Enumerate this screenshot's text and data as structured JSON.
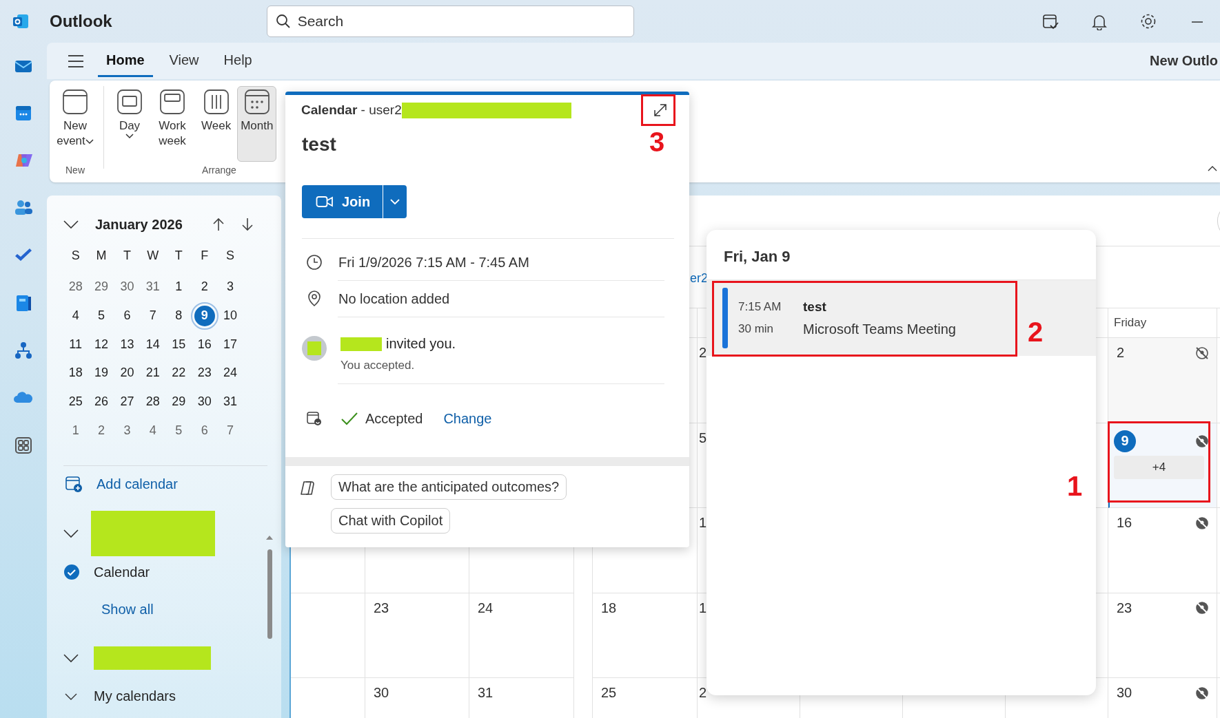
{
  "title_bar": {
    "app_name": "Outlook",
    "search": {
      "placeholder": "Search"
    }
  },
  "ribbon_tabs": [
    {
      "label": "Home",
      "selected": true
    },
    {
      "label": "View",
      "selected": false
    },
    {
      "label": "Help",
      "selected": false
    }
  ],
  "ribbon_banner": "New Outlo",
  "ribbon": {
    "groups": [
      {
        "label": "New",
        "buttons": [
          {
            "label": "New event",
            "kind": "event",
            "dropdown": true,
            "selected": false
          }
        ]
      },
      {
        "label": "Arrange",
        "buttons": [
          {
            "label": "Day",
            "kind": "day",
            "dropdown": true,
            "selected": false
          },
          {
            "label": "Work week",
            "kind": "workweek",
            "dropdown": false,
            "selected": false
          },
          {
            "label": "Week",
            "kind": "week",
            "dropdown": false,
            "selected": false
          },
          {
            "label": "Month",
            "kind": "month",
            "dropdown": false,
            "selected": true
          }
        ]
      }
    ]
  },
  "mini_calendar": {
    "title": "January 2026",
    "weekdays": [
      "S",
      "M",
      "T",
      "W",
      "T",
      "F",
      "S"
    ],
    "weeks": [
      [
        {
          "day": "28",
          "outside": true,
          "selected": false
        },
        {
          "day": "29",
          "outside": true,
          "selected": false
        },
        {
          "day": "30",
          "outside": true,
          "selected": false
        },
        {
          "day": "31",
          "outside": true,
          "selected": false
        },
        {
          "day": "1",
          "outside": false,
          "selected": false
        },
        {
          "day": "2",
          "outside": false,
          "selected": false
        },
        {
          "day": "3",
          "outside": false,
          "selected": false
        }
      ],
      [
        {
          "day": "4",
          "outside": false,
          "selected": false
        },
        {
          "day": "5",
          "outside": false,
          "selected": false
        },
        {
          "day": "6",
          "outside": false,
          "selected": false
        },
        {
          "day": "7",
          "outside": false,
          "selected": false
        },
        {
          "day": "8",
          "outside": false,
          "selected": false
        },
        {
          "day": "9",
          "outside": false,
          "selected": true
        },
        {
          "day": "10",
          "outside": false,
          "selected": false
        }
      ],
      [
        {
          "day": "11",
          "outside": false,
          "selected": false
        },
        {
          "day": "12",
          "outside": false,
          "selected": false
        },
        {
          "day": "13",
          "outside": false,
          "selected": false
        },
        {
          "day": "14",
          "outside": false,
          "selected": false
        },
        {
          "day": "15",
          "outside": false,
          "selected": false
        },
        {
          "day": "16",
          "outside": false,
          "selected": false
        },
        {
          "day": "17",
          "outside": false,
          "selected": false
        }
      ],
      [
        {
          "day": "18",
          "outside": false,
          "selected": false
        },
        {
          "day": "19",
          "outside": false,
          "selected": false
        },
        {
          "day": "20",
          "outside": false,
          "selected": false
        },
        {
          "day": "21",
          "outside": false,
          "selected": false
        },
        {
          "day": "22",
          "outside": false,
          "selected": false
        },
        {
          "day": "23",
          "outside": false,
          "selected": false
        },
        {
          "day": "24",
          "outside": false,
          "selected": false
        }
      ],
      [
        {
          "day": "25",
          "outside": false,
          "selected": false
        },
        {
          "day": "26",
          "outside": false,
          "selected": false
        },
        {
          "day": "27",
          "outside": false,
          "selected": false
        },
        {
          "day": "28",
          "outside": false,
          "selected": false
        },
        {
          "day": "29",
          "outside": false,
          "selected": false
        },
        {
          "day": "30",
          "outside": false,
          "selected": false
        },
        {
          "day": "31",
          "outside": false,
          "selected": false
        }
      ],
      [
        {
          "day": "1",
          "outside": true,
          "selected": false
        },
        {
          "day": "2",
          "outside": true,
          "selected": false
        },
        {
          "day": "3",
          "outside": true,
          "selected": false
        },
        {
          "day": "4",
          "outside": true,
          "selected": false
        },
        {
          "day": "5",
          "outside": true,
          "selected": false
        },
        {
          "day": "6",
          "outside": true,
          "selected": false
        },
        {
          "day": "7",
          "outside": true,
          "selected": false
        }
      ]
    ]
  },
  "add_calendar": "Add calendar",
  "calendar_groups": [
    {
      "expanded": true,
      "items": [
        {
          "label": "Calendar",
          "checked": true
        }
      ],
      "show_all": "Show all"
    },
    {
      "expanded": true,
      "subgroups": [
        {
          "label": "My calendars",
          "expanded": true
        }
      ]
    }
  ],
  "month_view": {
    "owner_fragment": "er2",
    "columns": [
      {
        "cells": [
          null,
          null,
          null,
          null,
          null
        ]
      },
      {
        "cells": [
          null,
          null,
          null,
          {
            "day": "23"
          },
          {
            "day": "30"
          }
        ]
      },
      {
        "cells": [
          null,
          null,
          null,
          {
            "day": "24"
          },
          {
            "day": "31"
          }
        ]
      },
      {
        "cells": [
          null,
          null,
          null,
          {
            "day": "18"
          },
          {
            "day": "25"
          }
        ]
      },
      {
        "cells": [
          {
            "day": "2"
          },
          {
            "day": "5"
          },
          {
            "day": "1"
          },
          {
            "day": "1"
          },
          {
            "day": "2"
          }
        ]
      },
      {
        "cells": [
          null,
          null,
          null,
          null,
          null
        ]
      },
      {
        "cells": [
          null,
          null,
          null,
          null,
          null
        ]
      },
      {
        "cells": [
          null,
          null,
          null,
          null,
          null
        ]
      },
      {
        "header": "Friday",
        "cells": [
          {
            "day": "2",
            "past": true,
            "visibility_off": true
          },
          {
            "day": "9",
            "selected": true,
            "more": "+4",
            "visibility_off": true
          },
          {
            "day": "16",
            "visibility_off": true
          },
          {
            "day": "23",
            "visibility_off": true
          },
          {
            "day": "30",
            "visibility_off": true
          }
        ]
      },
      {
        "cells": [
          null,
          null,
          null,
          null,
          null
        ]
      }
    ]
  },
  "event_card": {
    "calendar_label": "Calendar",
    "account": "- user2",
    "title": "test",
    "join": "Join",
    "when": "Fri 1/9/2026 7:15 AM - 7:45 AM",
    "location": "No location added",
    "invite": "invited you.",
    "response_note": "You accepted.",
    "response": "Accepted",
    "change": "Change",
    "copilot_prompts": [
      "What are the anticipated outcomes?",
      "Chat with Copilot"
    ]
  },
  "day_popup": {
    "title": "Fri, Jan 9",
    "events": [
      {
        "time": "7:15 AM",
        "duration": "30 min",
        "title": "test",
        "subtitle": "Microsoft Teams Meeting"
      }
    ]
  },
  "annotations": [
    {
      "label": "1"
    },
    {
      "label": "2"
    },
    {
      "label": "3"
    }
  ]
}
